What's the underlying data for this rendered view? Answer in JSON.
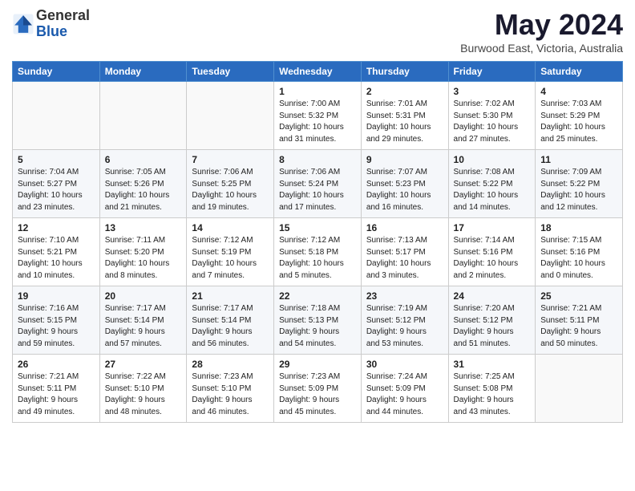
{
  "logo": {
    "general": "General",
    "blue": "Blue"
  },
  "title": "May 2024",
  "subtitle": "Burwood East, Victoria, Australia",
  "days_of_week": [
    "Sunday",
    "Monday",
    "Tuesday",
    "Wednesday",
    "Thursday",
    "Friday",
    "Saturday"
  ],
  "weeks": [
    [
      {
        "day": "",
        "info": ""
      },
      {
        "day": "",
        "info": ""
      },
      {
        "day": "",
        "info": ""
      },
      {
        "day": "1",
        "info": "Sunrise: 7:00 AM\nSunset: 5:32 PM\nDaylight: 10 hours\nand 31 minutes."
      },
      {
        "day": "2",
        "info": "Sunrise: 7:01 AM\nSunset: 5:31 PM\nDaylight: 10 hours\nand 29 minutes."
      },
      {
        "day": "3",
        "info": "Sunrise: 7:02 AM\nSunset: 5:30 PM\nDaylight: 10 hours\nand 27 minutes."
      },
      {
        "day": "4",
        "info": "Sunrise: 7:03 AM\nSunset: 5:29 PM\nDaylight: 10 hours\nand 25 minutes."
      }
    ],
    [
      {
        "day": "5",
        "info": "Sunrise: 7:04 AM\nSunset: 5:27 PM\nDaylight: 10 hours\nand 23 minutes."
      },
      {
        "day": "6",
        "info": "Sunrise: 7:05 AM\nSunset: 5:26 PM\nDaylight: 10 hours\nand 21 minutes."
      },
      {
        "day": "7",
        "info": "Sunrise: 7:06 AM\nSunset: 5:25 PM\nDaylight: 10 hours\nand 19 minutes."
      },
      {
        "day": "8",
        "info": "Sunrise: 7:06 AM\nSunset: 5:24 PM\nDaylight: 10 hours\nand 17 minutes."
      },
      {
        "day": "9",
        "info": "Sunrise: 7:07 AM\nSunset: 5:23 PM\nDaylight: 10 hours\nand 16 minutes."
      },
      {
        "day": "10",
        "info": "Sunrise: 7:08 AM\nSunset: 5:22 PM\nDaylight: 10 hours\nand 14 minutes."
      },
      {
        "day": "11",
        "info": "Sunrise: 7:09 AM\nSunset: 5:22 PM\nDaylight: 10 hours\nand 12 minutes."
      }
    ],
    [
      {
        "day": "12",
        "info": "Sunrise: 7:10 AM\nSunset: 5:21 PM\nDaylight: 10 hours\nand 10 minutes."
      },
      {
        "day": "13",
        "info": "Sunrise: 7:11 AM\nSunset: 5:20 PM\nDaylight: 10 hours\nand 8 minutes."
      },
      {
        "day": "14",
        "info": "Sunrise: 7:12 AM\nSunset: 5:19 PM\nDaylight: 10 hours\nand 7 minutes."
      },
      {
        "day": "15",
        "info": "Sunrise: 7:12 AM\nSunset: 5:18 PM\nDaylight: 10 hours\nand 5 minutes."
      },
      {
        "day": "16",
        "info": "Sunrise: 7:13 AM\nSunset: 5:17 PM\nDaylight: 10 hours\nand 3 minutes."
      },
      {
        "day": "17",
        "info": "Sunrise: 7:14 AM\nSunset: 5:16 PM\nDaylight: 10 hours\nand 2 minutes."
      },
      {
        "day": "18",
        "info": "Sunrise: 7:15 AM\nSunset: 5:16 PM\nDaylight: 10 hours\nand 0 minutes."
      }
    ],
    [
      {
        "day": "19",
        "info": "Sunrise: 7:16 AM\nSunset: 5:15 PM\nDaylight: 9 hours\nand 59 minutes."
      },
      {
        "day": "20",
        "info": "Sunrise: 7:17 AM\nSunset: 5:14 PM\nDaylight: 9 hours\nand 57 minutes."
      },
      {
        "day": "21",
        "info": "Sunrise: 7:17 AM\nSunset: 5:14 PM\nDaylight: 9 hours\nand 56 minutes."
      },
      {
        "day": "22",
        "info": "Sunrise: 7:18 AM\nSunset: 5:13 PM\nDaylight: 9 hours\nand 54 minutes."
      },
      {
        "day": "23",
        "info": "Sunrise: 7:19 AM\nSunset: 5:12 PM\nDaylight: 9 hours\nand 53 minutes."
      },
      {
        "day": "24",
        "info": "Sunrise: 7:20 AM\nSunset: 5:12 PM\nDaylight: 9 hours\nand 51 minutes."
      },
      {
        "day": "25",
        "info": "Sunrise: 7:21 AM\nSunset: 5:11 PM\nDaylight: 9 hours\nand 50 minutes."
      }
    ],
    [
      {
        "day": "26",
        "info": "Sunrise: 7:21 AM\nSunset: 5:11 PM\nDaylight: 9 hours\nand 49 minutes."
      },
      {
        "day": "27",
        "info": "Sunrise: 7:22 AM\nSunset: 5:10 PM\nDaylight: 9 hours\nand 48 minutes."
      },
      {
        "day": "28",
        "info": "Sunrise: 7:23 AM\nSunset: 5:10 PM\nDaylight: 9 hours\nand 46 minutes."
      },
      {
        "day": "29",
        "info": "Sunrise: 7:23 AM\nSunset: 5:09 PM\nDaylight: 9 hours\nand 45 minutes."
      },
      {
        "day": "30",
        "info": "Sunrise: 7:24 AM\nSunset: 5:09 PM\nDaylight: 9 hours\nand 44 minutes."
      },
      {
        "day": "31",
        "info": "Sunrise: 7:25 AM\nSunset: 5:08 PM\nDaylight: 9 hours\nand 43 minutes."
      },
      {
        "day": "",
        "info": ""
      }
    ]
  ]
}
